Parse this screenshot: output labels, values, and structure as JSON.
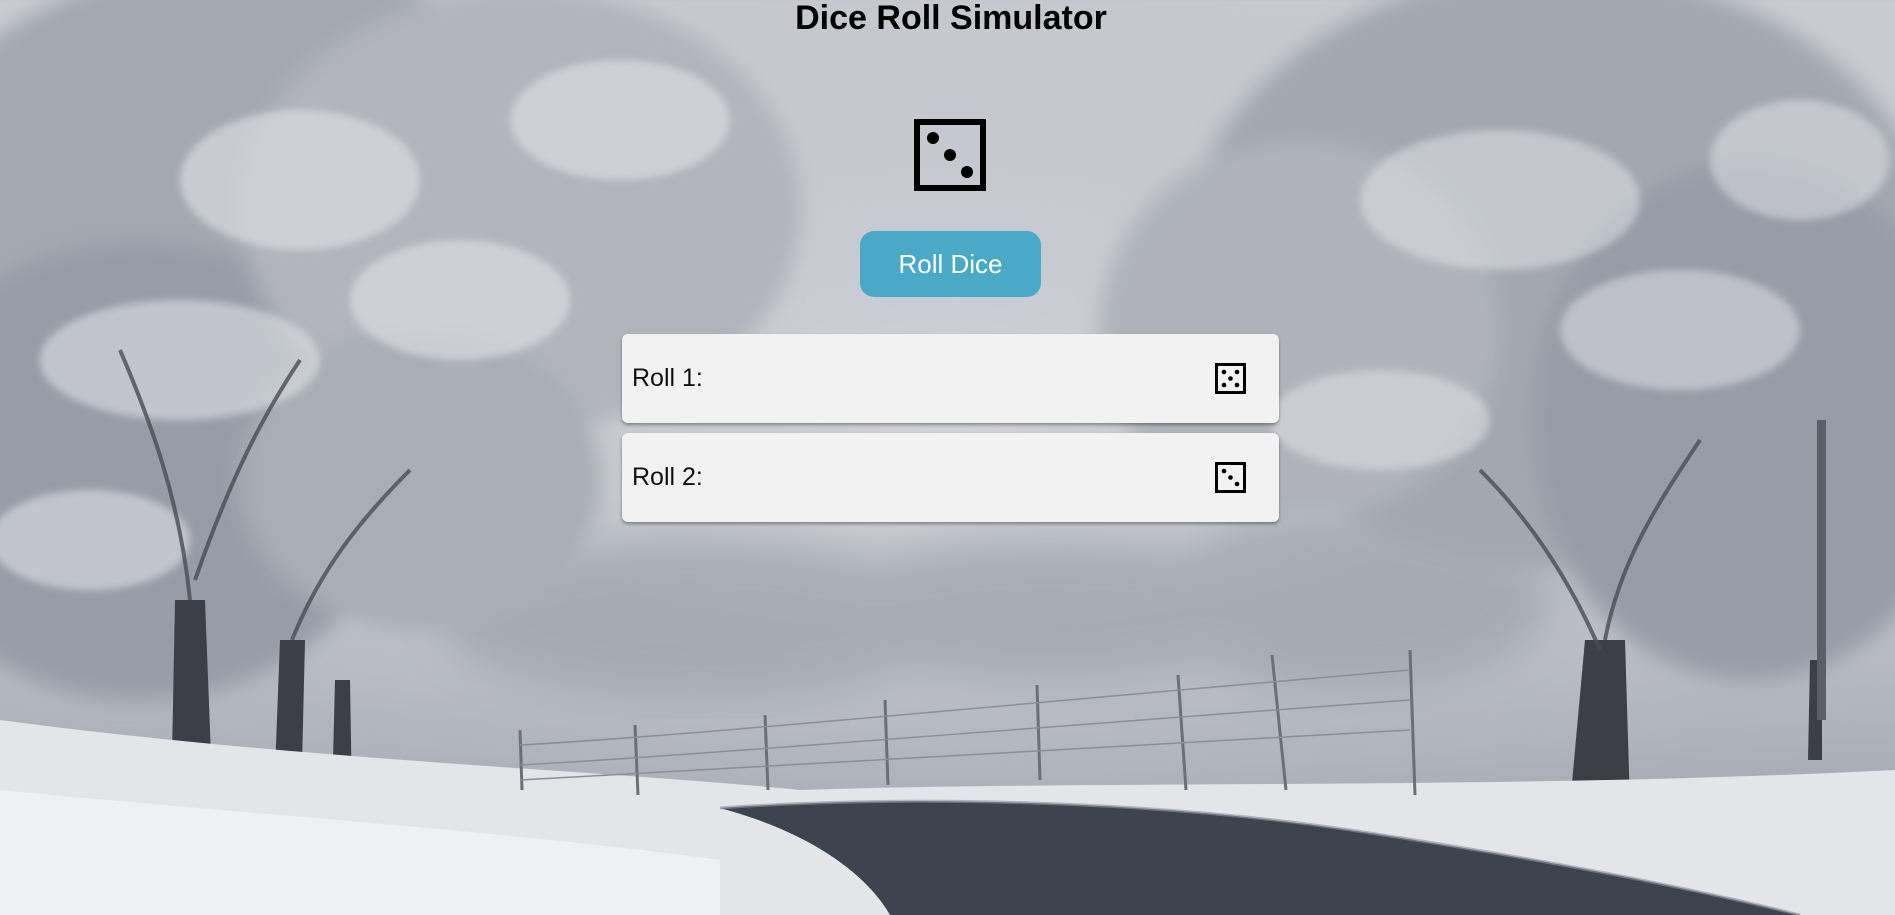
{
  "page": {
    "title": "Dice Roll Simulator"
  },
  "main_die": {
    "icon": "die-face-3-icon",
    "face_value": 3
  },
  "roll_button": {
    "label": "Roll Dice",
    "color": "#4ba9c8",
    "text_color": "#ffffff"
  },
  "history": {
    "items": [
      {
        "label": "Roll 1:",
        "face_value": 5,
        "icon": "die-face-5-icon"
      },
      {
        "label": "Roll 2:",
        "face_value": 3,
        "icon": "die-face-3-icon"
      }
    ]
  },
  "background": {
    "description_icon": "snowy-road-background",
    "colors": [
      "#c9cbd2",
      "#8f95a2",
      "#4a4e57",
      "#eceef1"
    ]
  }
}
